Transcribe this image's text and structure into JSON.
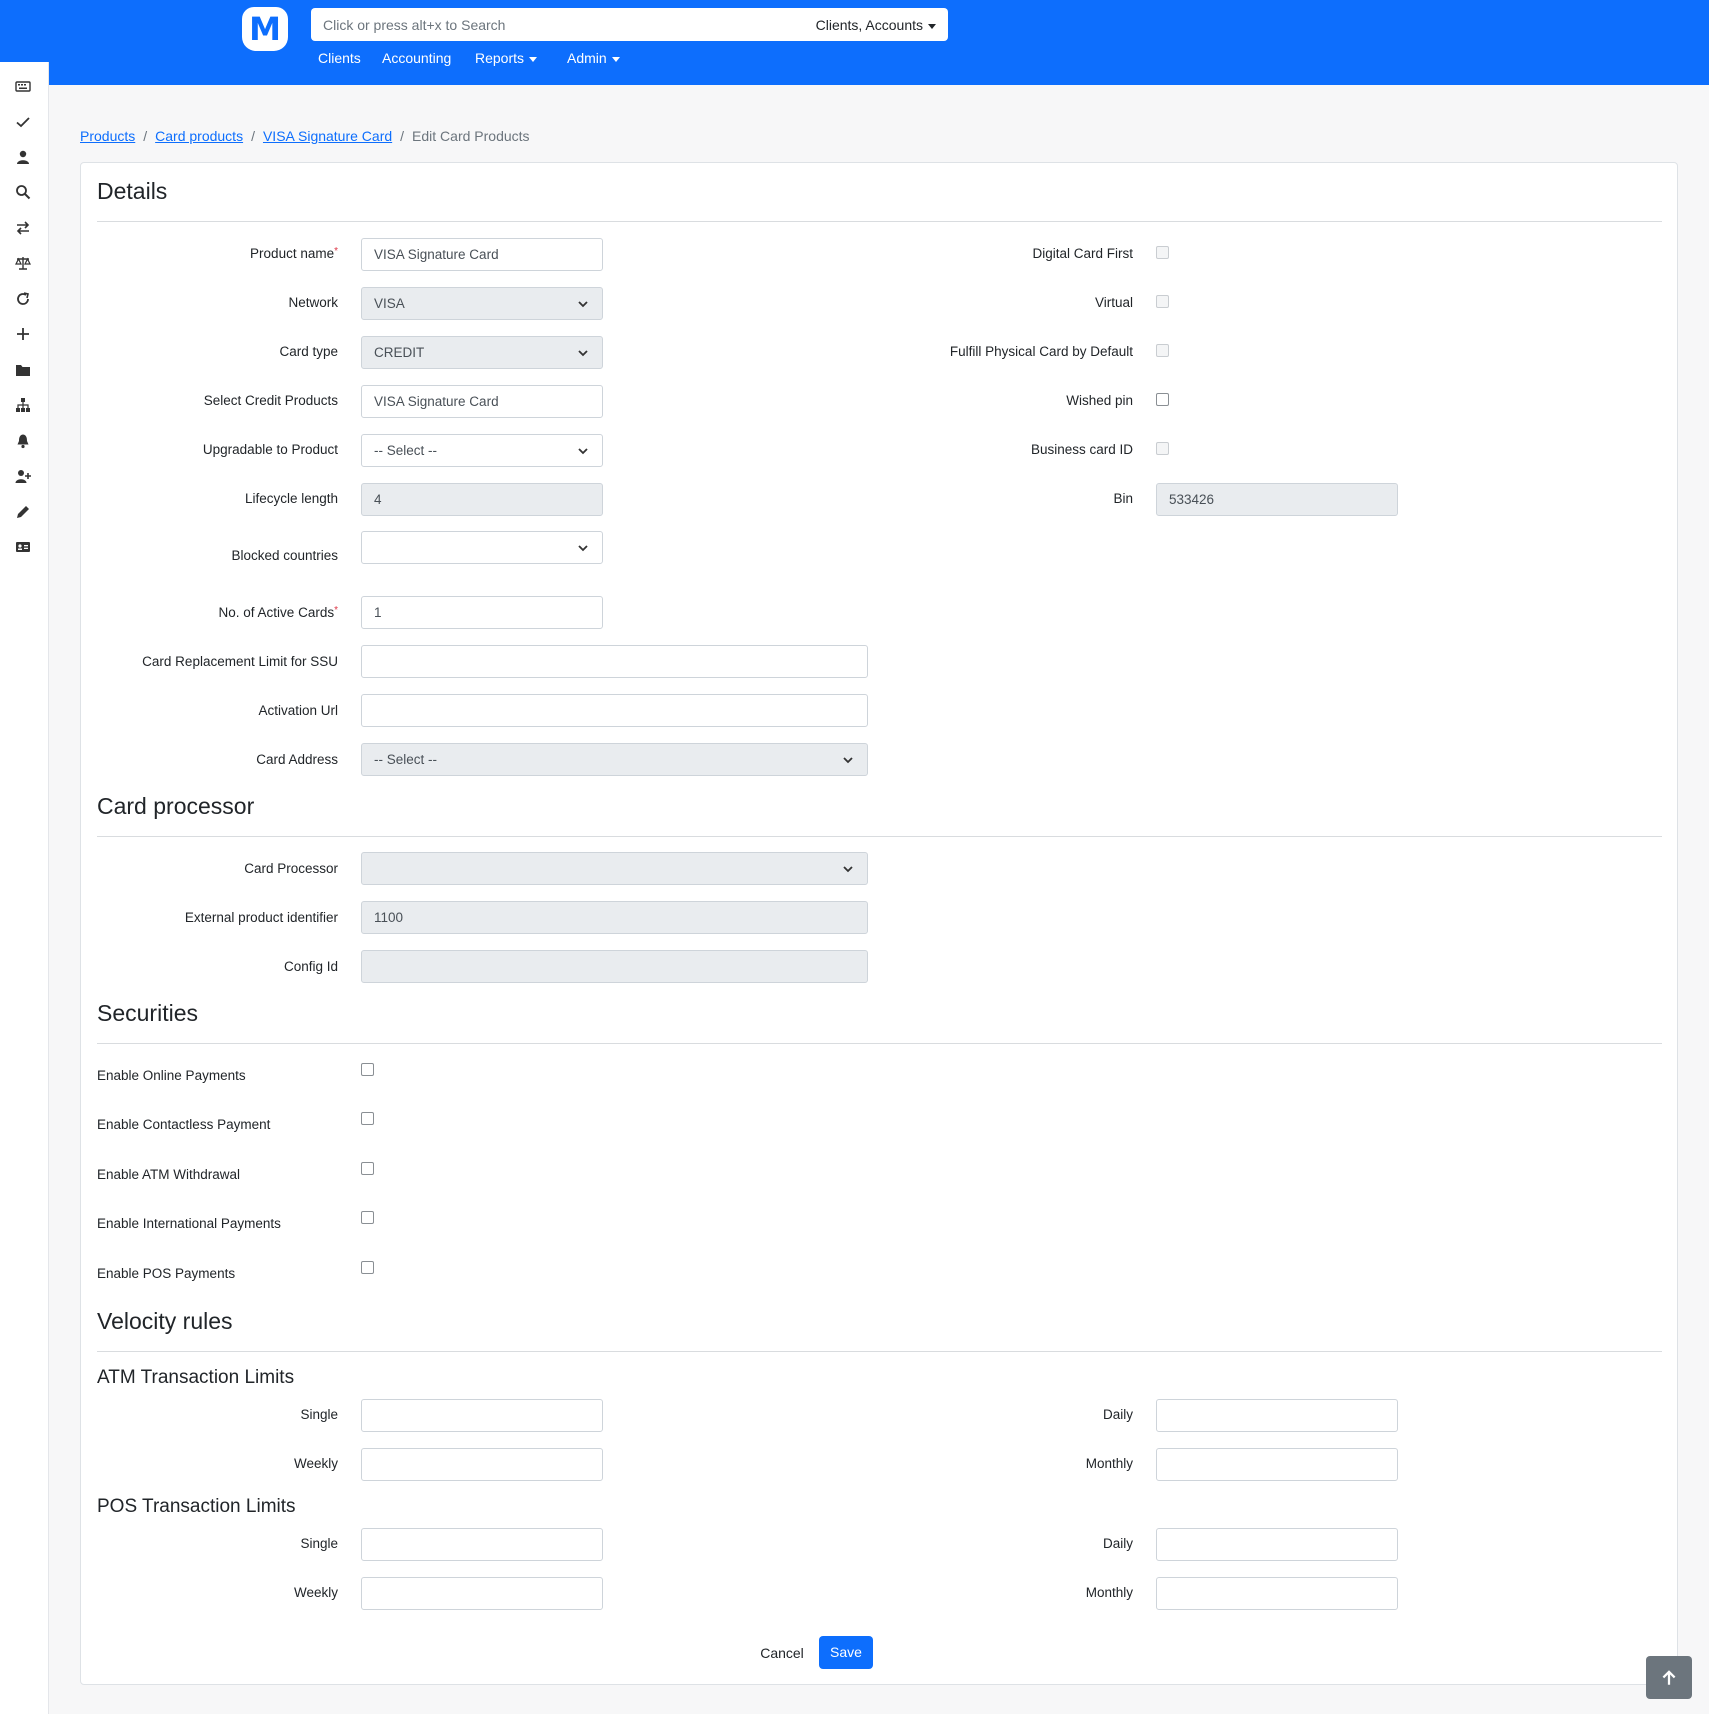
{
  "header": {
    "logo_letter": "M",
    "search_placeholder": "Click or press alt+x to Search",
    "search_scope": "Clients, Accounts",
    "nav": {
      "clients": "Clients",
      "accounting": "Accounting",
      "reports": "Reports",
      "admin": "Admin"
    }
  },
  "sidebar_icons": [
    "keyboard-icon",
    "check-icon",
    "user-icon",
    "search-icon",
    "transfer-icon",
    "balance-scale-icon",
    "refresh-icon",
    "plus-icon",
    "folder-icon",
    "org-chart-icon",
    "bell-icon",
    "add-user-icon",
    "pencil-icon",
    "id-card-icon"
  ],
  "breadcrumb": {
    "products": "Products",
    "card_products": "Card products",
    "visa_signature_card": "VISA Signature Card",
    "current": "Edit Card Products"
  },
  "details": {
    "title": "Details",
    "product_name_label": "Product name",
    "product_name_value": "VISA Signature Card",
    "network_label": "Network",
    "network_value": "VISA",
    "card_type_label": "Card type",
    "card_type_value": "CREDIT",
    "select_credit_products_label": "Select Credit Products",
    "select_credit_products_value": "VISA Signature Card",
    "upgradable_label": "Upgradable to Product",
    "upgradable_value": "-- Select --",
    "lifecycle_label": "Lifecycle length",
    "lifecycle_value": "4",
    "blocked_countries_label": "Blocked countries",
    "blocked_countries_value": "",
    "active_cards_label": "No. of Active Cards",
    "active_cards_value": "1",
    "replacement_limit_label": "Card Replacement Limit for SSU",
    "replacement_limit_value": "",
    "activation_url_label": "Activation Url",
    "activation_url_value": "",
    "card_address_label": "Card Address",
    "card_address_value": "-- Select --",
    "digital_card_first_label": "Digital Card First",
    "virtual_label": "Virtual",
    "fulfill_physical_label": "Fulfill Physical Card by Default",
    "wished_pin_label": "Wished pin",
    "business_card_id_label": "Business card ID",
    "bin_label": "Bin",
    "bin_value": "533426"
  },
  "card_processor": {
    "title": "Card processor",
    "processor_label": "Card Processor",
    "processor_value": "",
    "external_id_label": "External product identifier",
    "external_id_value": "1100",
    "config_id_label": "Config Id",
    "config_id_value": ""
  },
  "securities": {
    "title": "Securities",
    "online_payments": "Enable Online Payments",
    "contactless_payment": "Enable Contactless Payment",
    "atm_withdrawal": "Enable ATM Withdrawal",
    "international_payments": "Enable International Payments",
    "pos_payments": "Enable POS Payments"
  },
  "velocity": {
    "title": "Velocity rules",
    "atm_title": "ATM Transaction Limits",
    "pos_title": "POS Transaction Limits",
    "single_label": "Single",
    "daily_label": "Daily",
    "weekly_label": "Weekly",
    "monthly_label": "Monthly"
  },
  "actions": {
    "cancel": "Cancel",
    "save": "Save"
  },
  "colors": {
    "brand": "#0d6efd",
    "scroll_top_button": "#6c757d"
  }
}
